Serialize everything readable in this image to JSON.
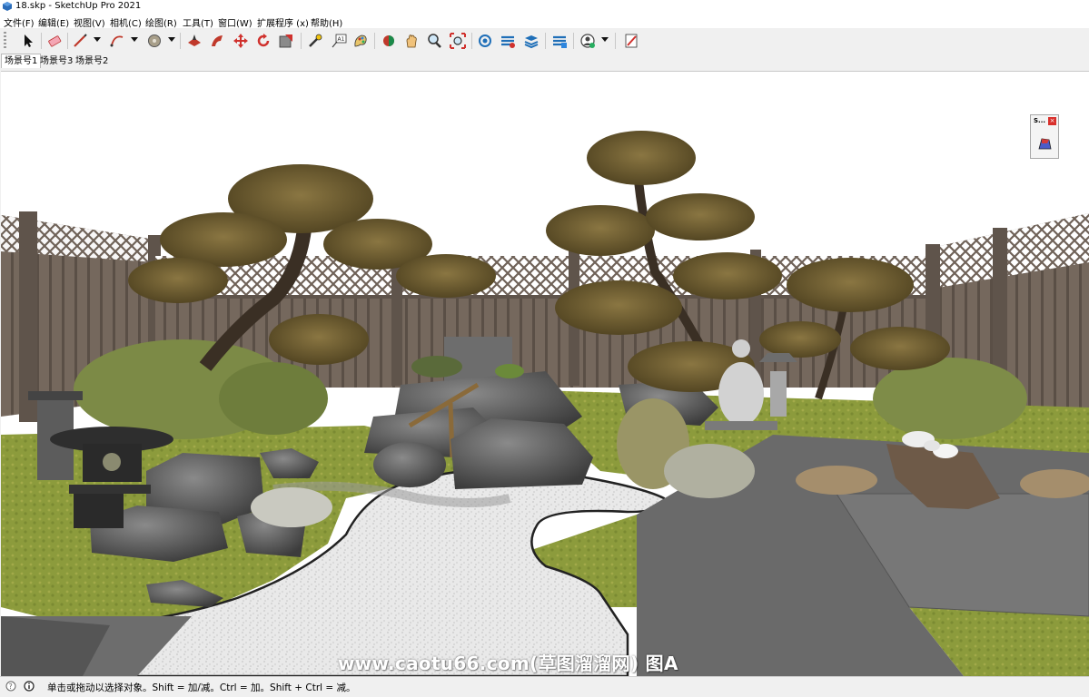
{
  "window": {
    "title": "18.skp - SketchUp Pro 2021"
  },
  "menu": [
    {
      "label": "文件(F)"
    },
    {
      "label": "编辑(E)"
    },
    {
      "label": "视图(V)"
    },
    {
      "label": "相机(C)"
    },
    {
      "label": "绘图(R)"
    },
    {
      "label": "工具(T)"
    },
    {
      "label": "窗口(W)"
    },
    {
      "label": "扩展程序 (x)"
    },
    {
      "label": "帮助(H)"
    }
  ],
  "toolbar": {
    "tools": [
      {
        "name": "select-tool-icon"
      },
      {
        "name": "eraser-tool-icon"
      },
      {
        "name": "line-tool-icon"
      },
      {
        "name": "arc-tool-icon"
      },
      {
        "name": "paint-bucket-icon"
      },
      {
        "name": "push-pull-icon"
      },
      {
        "name": "follow-me-icon"
      },
      {
        "name": "move-tool-icon"
      },
      {
        "name": "rotate-tool-icon"
      },
      {
        "name": "scale-tool-icon"
      },
      {
        "name": "tape-measure-icon"
      },
      {
        "name": "text-tool-icon"
      },
      {
        "name": "paint-tool-icon"
      },
      {
        "name": "orbit-tool-icon"
      },
      {
        "name": "pan-tool-icon"
      },
      {
        "name": "zoom-tool-icon"
      },
      {
        "name": "zoom-extents-icon"
      },
      {
        "name": "3d-warehouse-icon"
      },
      {
        "name": "extension-warehouse-icon"
      },
      {
        "name": "layout-icon"
      },
      {
        "name": "extension-manager-icon"
      },
      {
        "name": "account-icon"
      },
      {
        "name": "send-to-layout-icon"
      }
    ]
  },
  "scenes": [
    {
      "label": "场景号1",
      "active": true
    },
    {
      "label": "场景号3",
      "active": false
    },
    {
      "label": "场景号2",
      "active": false
    }
  ],
  "mini_panel": {
    "title": "S...",
    "close": "×"
  },
  "watermark": "www.caotu66.com(草图溜溜网) 图A",
  "status": {
    "text": "单击或拖动以选择对象。Shift = 加/减。Ctrl = 加。Shift + Ctrl = 减。"
  },
  "colors": {
    "fence": "#6f6258",
    "lawn": "#8a9a3a",
    "gravel": "#e8e8e8",
    "paving": "#6b6b6b",
    "pine": "#6b5a2a"
  }
}
